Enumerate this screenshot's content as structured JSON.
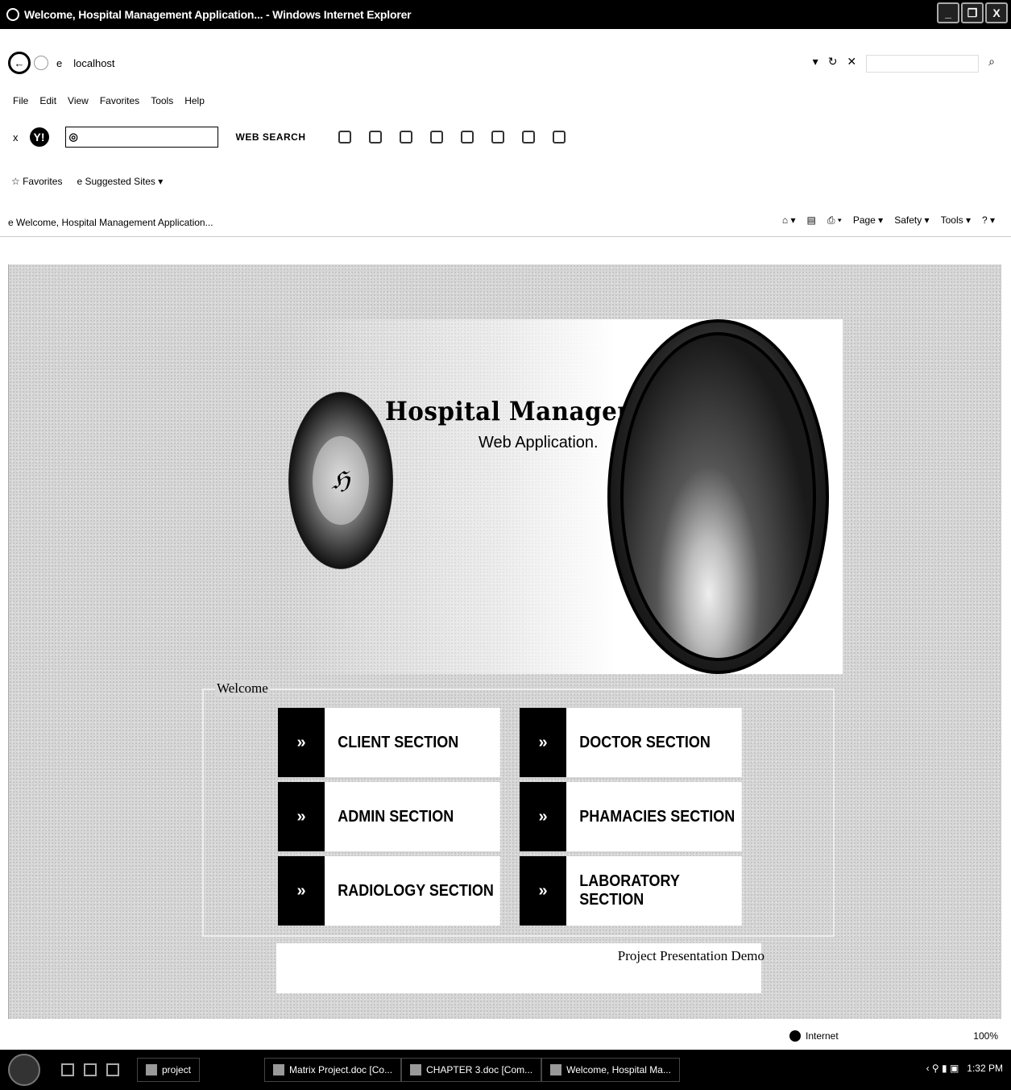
{
  "window": {
    "title": "Welcome, Hospital Management Application... - Windows Internet Explorer",
    "buttons": [
      "_",
      "❐",
      "X"
    ]
  },
  "address": {
    "url": "localhost",
    "back_icon": "back-icon",
    "forward_icon": "forward-icon"
  },
  "menu": [
    "File",
    "Edit",
    "View",
    "Favorites",
    "Tools",
    "Help"
  ],
  "yahoo": {
    "logo": "Y!",
    "web_search": "WEB SEARCH"
  },
  "favorites": {
    "label": "Favorites",
    "suggested": "Suggested Sites ▾"
  },
  "tab": {
    "label": "Welcome, Hospital Management Application...",
    "commands": [
      "Page ▾",
      "Safety ▾",
      "Tools ▾"
    ]
  },
  "banner": {
    "title": "Hospital Management",
    "subtitle": "Web Application."
  },
  "welcome": {
    "label": "Welcome",
    "arrow": "»",
    "sections": [
      "CLIENT SECTION",
      "DOCTOR SECTION",
      "ADMIN SECTION",
      "PHAMACIES SECTION",
      "RADIOLOGY SECTION",
      "LABORATORY SECTION"
    ]
  },
  "footer": {
    "text": "Project Presentation Demo"
  },
  "status": {
    "zone": "Internet",
    "zoom": "100%"
  },
  "taskbar": {
    "items": [
      "project",
      "Matrix Project.doc [Co...",
      "CHAPTER 3.doc [Com...",
      "Welcome, Hospital Ma..."
    ],
    "clock": "1:32 PM"
  }
}
